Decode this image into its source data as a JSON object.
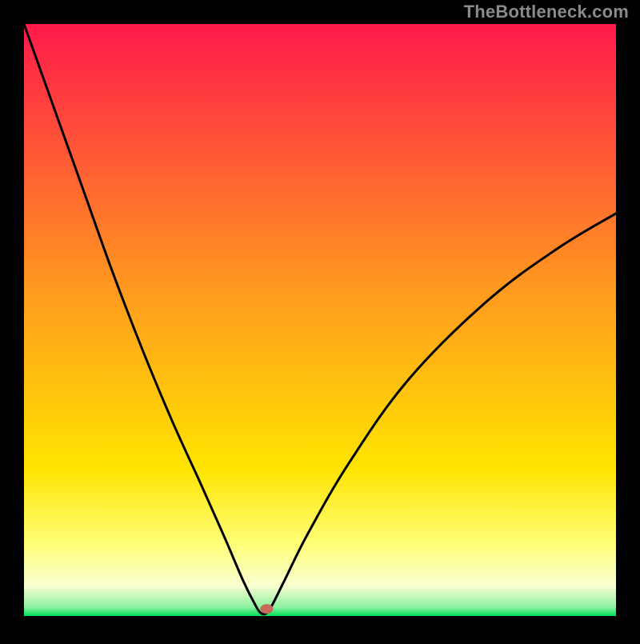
{
  "watermark": "TheBottleneck.com",
  "chart_data": {
    "type": "line",
    "title": "",
    "xlabel": "",
    "ylabel": "",
    "xlim": [
      0,
      100
    ],
    "ylim": [
      0,
      100
    ],
    "grid": false,
    "legend": false,
    "background_gradient": {
      "type": "vertical",
      "stops": [
        {
          "offset": 0.0,
          "color": "#ff1a4b"
        },
        {
          "offset": 0.45,
          "color": "#ff9a1f"
        },
        {
          "offset": 0.75,
          "color": "#ffe400"
        },
        {
          "offset": 0.88,
          "color": "#ffff7a"
        },
        {
          "offset": 0.95,
          "color": "#f7ffd0"
        },
        {
          "offset": 0.985,
          "color": "#8cf0a0"
        },
        {
          "offset": 1.0,
          "color": "#00e05a"
        }
      ]
    },
    "series": [
      {
        "name": "bottleneck-curve",
        "color": "#000000",
        "x": [
          0,
          5,
          10,
          15,
          20,
          25,
          30,
          34,
          37,
          39,
          40,
          41,
          42,
          44,
          48,
          55,
          65,
          78,
          90,
          100
        ],
        "y": [
          100,
          86,
          72,
          58,
          45,
          33,
          22,
          13,
          6,
          2,
          0.5,
          0.5,
          2,
          6,
          14,
          26,
          40,
          53,
          62,
          68
        ]
      }
    ],
    "markers": [
      {
        "name": "min-point",
        "x": 41,
        "y": 1.2,
        "color": "#c76a5a",
        "rx": 8,
        "ry": 6
      }
    ]
  }
}
